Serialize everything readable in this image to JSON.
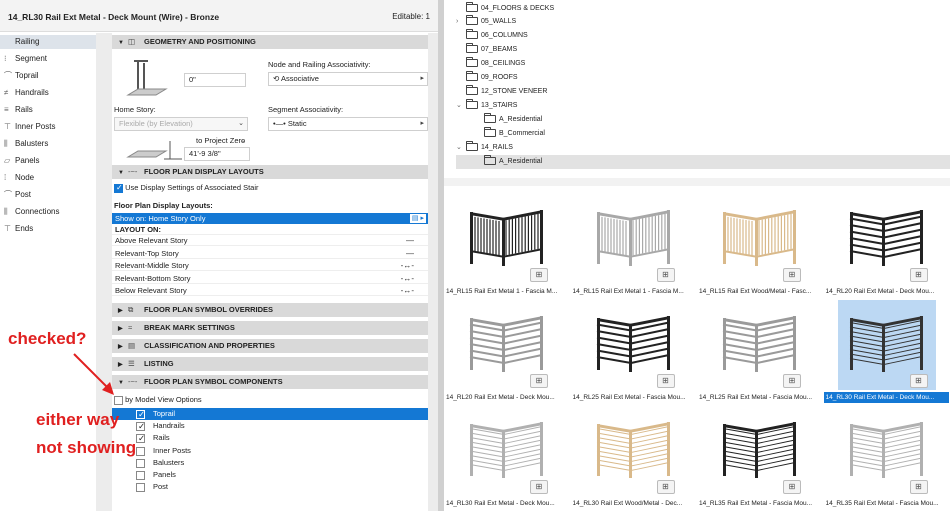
{
  "dialog": {
    "title": "14_RL30 Rail Ext Metal - Deck Mount (Wire) - Bronze",
    "editable": "Editable: 1"
  },
  "nav": [
    {
      "label": "Railing",
      "icon": "railing-icon",
      "active": true
    },
    {
      "label": "Segment",
      "icon": "segment-icon"
    },
    {
      "label": "Toprail",
      "icon": "toprail-icon"
    },
    {
      "label": "Handrails",
      "icon": "handrails-icon"
    },
    {
      "label": "Rails",
      "icon": "rails-icon"
    },
    {
      "label": "Inner Posts",
      "icon": "inner-posts-icon"
    },
    {
      "label": "Balusters",
      "icon": "balusters-icon"
    },
    {
      "label": "Panels",
      "icon": "panels-icon"
    },
    {
      "label": "Node",
      "icon": "node-icon"
    },
    {
      "label": "Post",
      "icon": "post-icon"
    },
    {
      "label": "Connections",
      "icon": "connections-icon"
    },
    {
      "label": "Ends",
      "icon": "ends-icon"
    }
  ],
  "geometry": {
    "header": "GEOMETRY AND POSITIONING",
    "offset_value": "0\"",
    "node_assoc_label": "Node and Railing Associativity:",
    "node_assoc_value": "Associative",
    "home_story_label": "Home Story:",
    "home_story_value": "Flexible (by Elevation)",
    "segment_assoc_label": "Segment Associativity:",
    "segment_assoc_value": "Static",
    "to_project_zero": "to Project Zero",
    "elevation_value": "41'-9 3/8\""
  },
  "floor_plan_layouts": {
    "header": "FLOOR PLAN DISPLAY LAYOUTS",
    "use_display_settings": "Use Display Settings of Associated Stair",
    "layouts_label": "Floor Plan Display Layouts:",
    "show_on": "Show on: Home Story Only",
    "layout_on": "LAYOUT ON:",
    "rows": [
      {
        "label": "Above Relevant Story",
        "mark": "—"
      },
      {
        "label": "Relevant-Top Story",
        "mark": "—"
      },
      {
        "label": "Relevant-Middle Story",
        "mark": "-↔-"
      },
      {
        "label": "Relevant-Bottom Story",
        "mark": "-↔-"
      },
      {
        "label": "Below Relevant Story",
        "mark": "-↔-"
      }
    ]
  },
  "sections": {
    "symbol_overrides": "FLOOR PLAN SYMBOL OVERRIDES",
    "break_mark": "BREAK MARK SETTINGS",
    "classification": "CLASSIFICATION AND PROPERTIES",
    "listing": "LISTING",
    "symbol_components": "FLOOR PLAN SYMBOL COMPONENTS"
  },
  "components": {
    "by_model_view": "by Model View Options",
    "items": [
      {
        "label": "Toprail",
        "checked": true,
        "selected": true
      },
      {
        "label": "Handrails",
        "checked": true
      },
      {
        "label": "Rails",
        "checked": true
      },
      {
        "label": "Inner Posts",
        "checked": false
      },
      {
        "label": "Balusters",
        "checked": false
      },
      {
        "label": "Panels",
        "checked": false
      },
      {
        "label": "Post",
        "checked": false
      }
    ]
  },
  "annotations": {
    "checked": "checked?",
    "either_way": "either way",
    "not_showing": "not showing",
    "color": "#e02020"
  },
  "tree": [
    {
      "label": "04_FLOORS & DECKS",
      "indent": 1
    },
    {
      "label": "05_WALLS",
      "indent": 0,
      "twisty": "›"
    },
    {
      "label": "06_COLUMNS",
      "indent": 1
    },
    {
      "label": "07_BEAMS",
      "indent": 1
    },
    {
      "label": "08_CEILINGS",
      "indent": 1
    },
    {
      "label": "09_ROOFS",
      "indent": 1
    },
    {
      "label": "12_STONE VENEER",
      "indent": 1
    },
    {
      "label": "13_STAIRS",
      "indent": 0,
      "twisty": "⌄"
    },
    {
      "label": "A_Residential",
      "indent": 2
    },
    {
      "label": "B_Commercial",
      "indent": 2
    },
    {
      "label": "14_RAILS",
      "indent": 0,
      "twisty": "⌄"
    },
    {
      "label": "A_Residential",
      "indent": 2,
      "selected": true
    }
  ],
  "tiles": [
    {
      "label": "14_RL15 Rail Ext Metal 1 - Fascia M...",
      "style": "balusters",
      "color": "#222222"
    },
    {
      "label": "14_RL15 Rail Ext Metal 1 - Fascia M...",
      "style": "balusters",
      "color": "#a8a8a8"
    },
    {
      "label": "14_RL15 Rail Ext Wood/Metal - Fasc...",
      "style": "balusters",
      "color": "#d9b98a"
    },
    {
      "label": "14_RL20 Rail Ext Metal - Deck Mou...",
      "style": "horizontal",
      "color": "#222222"
    },
    {
      "label": "14_RL20 Rail Ext Metal - Deck Mou...",
      "style": "horizontal",
      "color": "#9a9a9a"
    },
    {
      "label": "14_RL25 Rail Ext Metal - Fascia Mou...",
      "style": "horizontal",
      "color": "#222222"
    },
    {
      "label": "14_RL25 Rail Ext Metal - Fascia Mou...",
      "style": "horizontal",
      "color": "#9a9a9a"
    },
    {
      "label": "14_RL30 Rail Ext Metal - Deck Mou...",
      "style": "wire",
      "color": "#333333",
      "selected": true
    },
    {
      "label": "14_RL30 Rail Ext Metal - Deck Mou...",
      "style": "wire",
      "color": "#b0b0b0"
    },
    {
      "label": "14_RL30 Rail Ext Wood/Metal - Dec...",
      "style": "wire",
      "color": "#d9b98a"
    },
    {
      "label": "14_RL35 Rail Ext Metal - Fascia Mou...",
      "style": "wire",
      "color": "#222222"
    },
    {
      "label": "14_RL35 Rail Ext Metal - Fascia Mou...",
      "style": "wire",
      "color": "#b0b0b0"
    }
  ],
  "colors": {
    "accent": "#1478d4",
    "selected_tile": "#bcd8f3"
  }
}
